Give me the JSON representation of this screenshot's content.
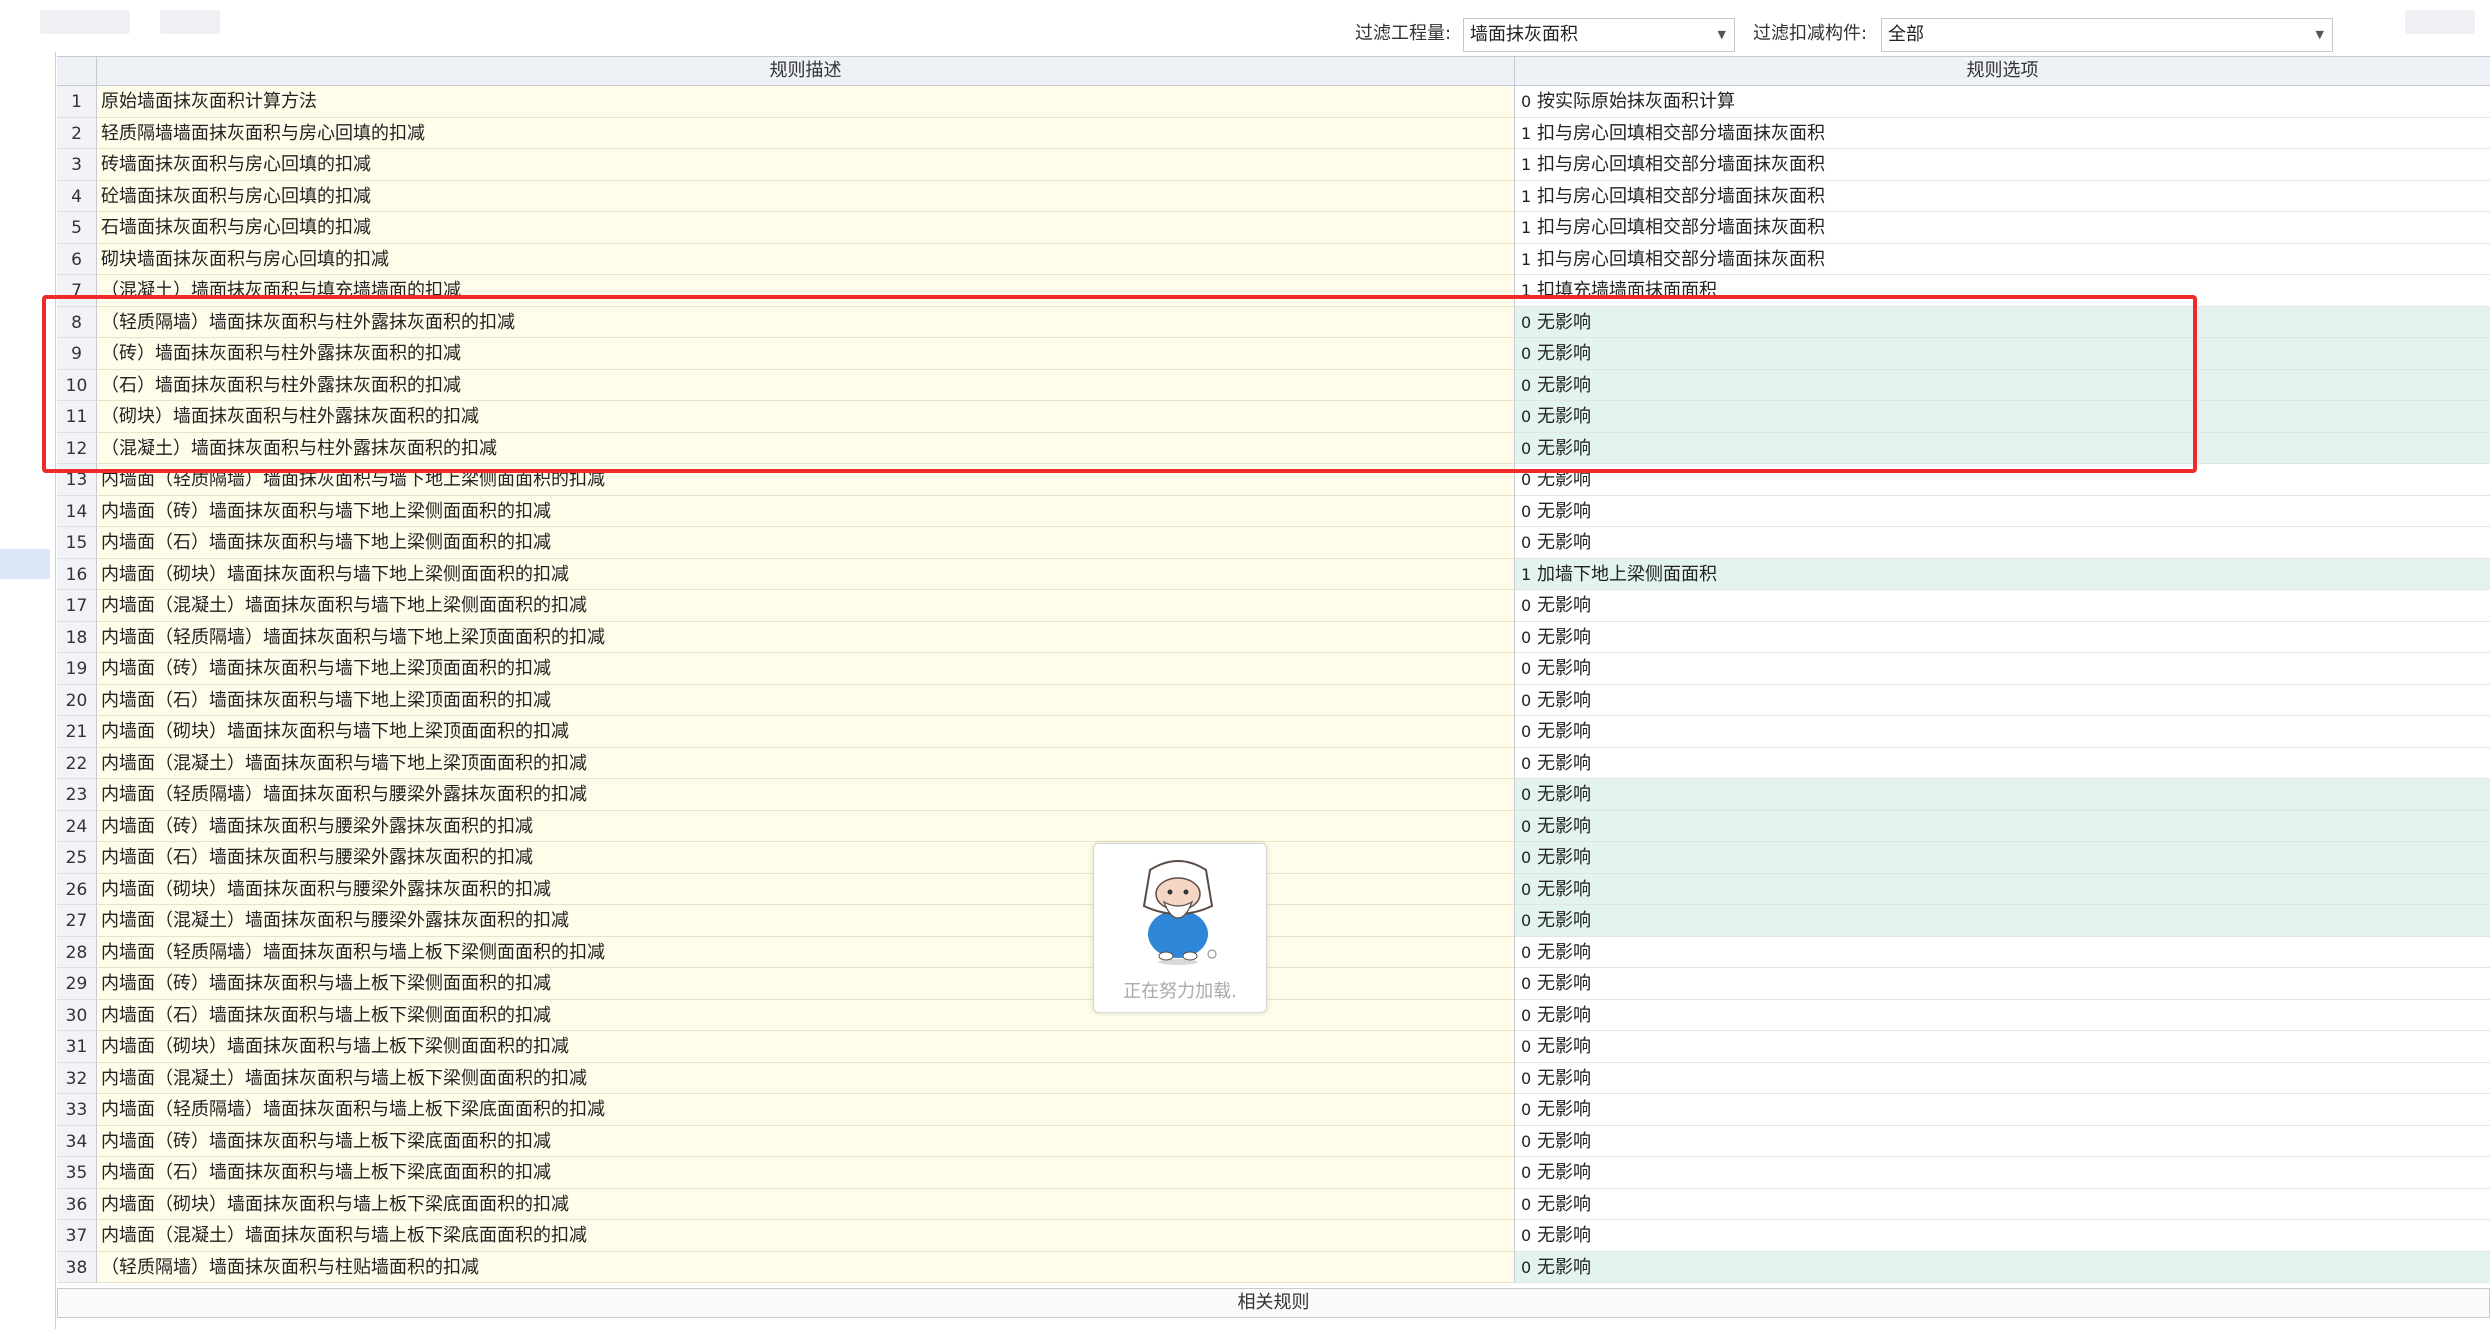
{
  "filters": {
    "quantity_label": "过滤工程量:",
    "quantity_value": "墙面抹灰面积",
    "component_label": "过滤扣减构件:",
    "component_value": "全部"
  },
  "table": {
    "headers": [
      "规则描述",
      "规则选项"
    ],
    "rows": [
      {
        "n": "1",
        "desc": "原始墙面抹灰面积计算方法",
        "code": "0",
        "opt": "按实际原始抹灰面积计算"
      },
      {
        "n": "2",
        "desc": "轻质隔墙墙面抹灰面积与房心回填的扣减",
        "code": "1",
        "opt": "扣与房心回填相交部分墙面抹灰面积"
      },
      {
        "n": "3",
        "desc": "砖墙面抹灰面积与房心回填的扣减",
        "code": "1",
        "opt": "扣与房心回填相交部分墙面抹灰面积"
      },
      {
        "n": "4",
        "desc": "砼墙面抹灰面积与房心回填的扣减",
        "code": "1",
        "opt": "扣与房心回填相交部分墙面抹灰面积"
      },
      {
        "n": "5",
        "desc": "石墙面抹灰面积与房心回填的扣减",
        "code": "1",
        "opt": "扣与房心回填相交部分墙面抹灰面积"
      },
      {
        "n": "6",
        "desc": "砌块墙面抹灰面积与房心回填的扣减",
        "code": "1",
        "opt": "扣与房心回填相交部分墙面抹灰面积"
      },
      {
        "n": "7",
        "desc": "（混凝土）墙面抹灰面积与填充墙墙面的扣减",
        "code": "1",
        "opt": "扣填充墙墙面抹面面积"
      },
      {
        "n": "8",
        "desc": "（轻质隔墙）墙面抹灰面积与柱外露抹灰面积的扣减",
        "code": "0",
        "opt": "无影响",
        "hl": true
      },
      {
        "n": "9",
        "desc": "（砖）墙面抹灰面积与柱外露抹灰面积的扣减",
        "code": "0",
        "opt": "无影响",
        "hl": true
      },
      {
        "n": "10",
        "desc": "（石）墙面抹灰面积与柱外露抹灰面积的扣减",
        "code": "0",
        "opt": "无影响",
        "hl": true
      },
      {
        "n": "11",
        "desc": "（砌块）墙面抹灰面积与柱外露抹灰面积的扣减",
        "code": "0",
        "opt": "无影响",
        "hl": true
      },
      {
        "n": "12",
        "desc": "（混凝土）墙面抹灰面积与柱外露抹灰面积的扣减",
        "code": "0",
        "opt": "无影响",
        "hl": true
      },
      {
        "n": "13",
        "desc": "内墙面（轻质隔墙）墙面抹灰面积与墙下地上梁侧面面积的扣减",
        "code": "0",
        "opt": "无影响"
      },
      {
        "n": "14",
        "desc": "内墙面（砖）墙面抹灰面积与墙下地上梁侧面面积的扣减",
        "code": "0",
        "opt": "无影响"
      },
      {
        "n": "15",
        "desc": "内墙面（石）墙面抹灰面积与墙下地上梁侧面面积的扣减",
        "code": "0",
        "opt": "无影响"
      },
      {
        "n": "16",
        "desc": "内墙面（砌块）墙面抹灰面积与墙下地上梁侧面面积的扣减",
        "code": "1",
        "opt": "加墙下地上梁侧面面积",
        "hl": true
      },
      {
        "n": "17",
        "desc": "内墙面（混凝土）墙面抹灰面积与墙下地上梁侧面面积的扣减",
        "code": "0",
        "opt": "无影响"
      },
      {
        "n": "18",
        "desc": "内墙面（轻质隔墙）墙面抹灰面积与墙下地上梁顶面面积的扣减",
        "code": "0",
        "opt": "无影响"
      },
      {
        "n": "19",
        "desc": "内墙面（砖）墙面抹灰面积与墙下地上梁顶面面积的扣减",
        "code": "0",
        "opt": "无影响"
      },
      {
        "n": "20",
        "desc": "内墙面（石）墙面抹灰面积与墙下地上梁顶面面积的扣减",
        "code": "0",
        "opt": "无影响"
      },
      {
        "n": "21",
        "desc": "内墙面（砌块）墙面抹灰面积与墙下地上梁顶面面积的扣减",
        "code": "0",
        "opt": "无影响"
      },
      {
        "n": "22",
        "desc": "内墙面（混凝土）墙面抹灰面积与墙下地上梁顶面面积的扣减",
        "code": "0",
        "opt": "无影响"
      },
      {
        "n": "23",
        "desc": "内墙面（轻质隔墙）墙面抹灰面积与腰梁外露抹灰面积的扣减",
        "code": "0",
        "opt": "无影响",
        "hl": true
      },
      {
        "n": "24",
        "desc": "内墙面（砖）墙面抹灰面积与腰梁外露抹灰面积的扣减",
        "code": "0",
        "opt": "无影响",
        "hl": true
      },
      {
        "n": "25",
        "desc": "内墙面（石）墙面抹灰面积与腰梁外露抹灰面积的扣减",
        "code": "0",
        "opt": "无影响",
        "hl": true
      },
      {
        "n": "26",
        "desc": "内墙面（砌块）墙面抹灰面积与腰梁外露抹灰面积的扣减",
        "code": "0",
        "opt": "无影响",
        "hl": true
      },
      {
        "n": "27",
        "desc": "内墙面（混凝土）墙面抹灰面积与腰梁外露抹灰面积的扣减",
        "code": "0",
        "opt": "无影响",
        "hl": true
      },
      {
        "n": "28",
        "desc": "内墙面（轻质隔墙）墙面抹灰面积与墙上板下梁侧面面积的扣减",
        "code": "0",
        "opt": "无影响"
      },
      {
        "n": "29",
        "desc": "内墙面（砖）墙面抹灰面积与墙上板下梁侧面面积的扣减",
        "code": "0",
        "opt": "无影响"
      },
      {
        "n": "30",
        "desc": "内墙面（石）墙面抹灰面积与墙上板下梁侧面面积的扣减",
        "code": "0",
        "opt": "无影响"
      },
      {
        "n": "31",
        "desc": "内墙面（砌块）墙面抹灰面积与墙上板下梁侧面面积的扣减",
        "code": "0",
        "opt": "无影响"
      },
      {
        "n": "32",
        "desc": "内墙面（混凝土）墙面抹灰面积与墙上板下梁侧面面积的扣减",
        "code": "0",
        "opt": "无影响"
      },
      {
        "n": "33",
        "desc": "内墙面（轻质隔墙）墙面抹灰面积与墙上板下梁底面面积的扣减",
        "code": "0",
        "opt": "无影响"
      },
      {
        "n": "34",
        "desc": "内墙面（砖）墙面抹灰面积与墙上板下梁底面面积的扣减",
        "code": "0",
        "opt": "无影响"
      },
      {
        "n": "35",
        "desc": "内墙面（石）墙面抹灰面积与墙上板下梁底面面积的扣减",
        "code": "0",
        "opt": "无影响"
      },
      {
        "n": "36",
        "desc": "内墙面（砌块）墙面抹灰面积与墙上板下梁底面面积的扣减",
        "code": "0",
        "opt": "无影响"
      },
      {
        "n": "37",
        "desc": "内墙面（混凝土）墙面抹灰面积与墙上板下梁底面面积的扣减",
        "code": "0",
        "opt": "无影响"
      },
      {
        "n": "38",
        "desc": "（轻质隔墙）墙面抹灰面积与柱贴墙面积的扣减",
        "code": "0",
        "opt": "无影响",
        "hl": true
      }
    ]
  },
  "footer": {
    "label": "相关规则"
  },
  "loading": {
    "text": "正在努力加载."
  },
  "colors": {
    "highlight_box": "#ee2a2a",
    "desc_bg": "#fffdea",
    "option_hl_bg": "#e3f4ee"
  }
}
